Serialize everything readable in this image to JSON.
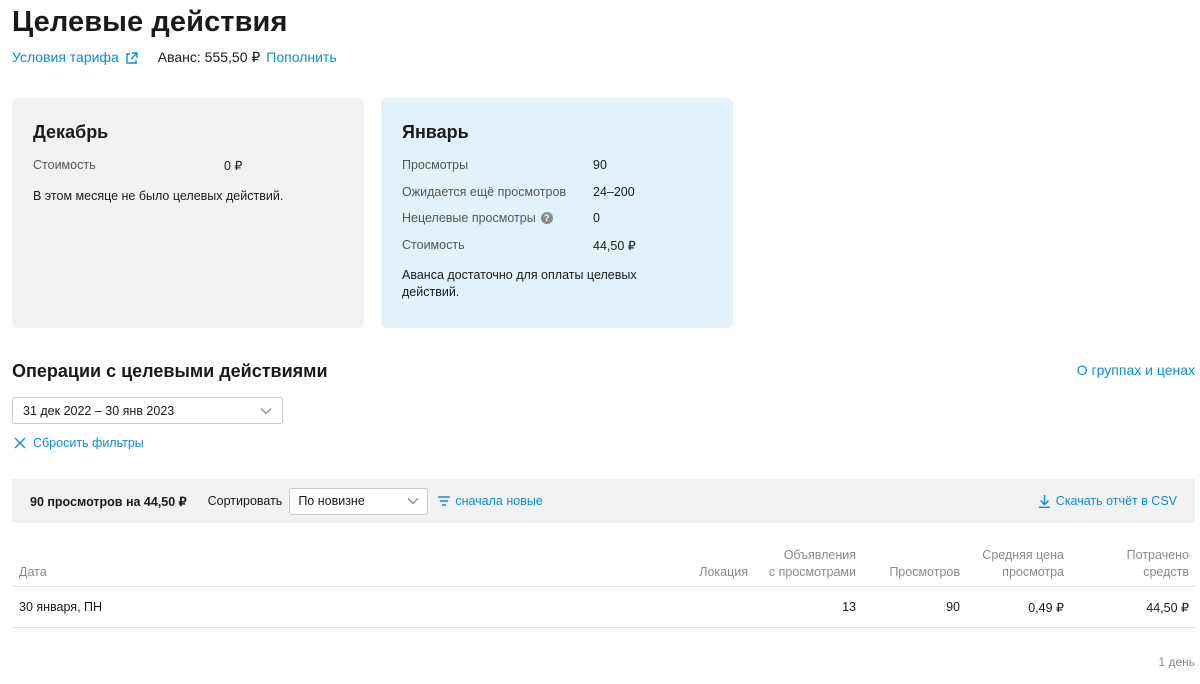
{
  "page": {
    "title": "Целевые действия",
    "tariff_link": "Условия тарифа",
    "advance": "Аванс: 555,50 ₽",
    "topup_link": "Пополнить"
  },
  "cards": {
    "december": {
      "title": "Декабрь",
      "rows": [
        {
          "label": "Стоимость",
          "value": "0 ₽"
        }
      ],
      "note": "В этом месяце не было целевых действий."
    },
    "january": {
      "title": "Январь",
      "rows": [
        {
          "label": "Просмотры",
          "value": "90"
        },
        {
          "label": "Ожидается ещё просмотров",
          "value": "24–200"
        },
        {
          "label": "Нецелевые просмотры",
          "value": "0"
        },
        {
          "label": "Стоимость",
          "value": "44,50 ₽"
        }
      ],
      "note": "Аванса достаточно для оплаты целевых действий."
    }
  },
  "operations": {
    "title": "Операции с целевыми действиями",
    "groups_link": "О группах и ценах",
    "date_range": "31 дек 2022 – 30 янв 2023",
    "reset_filters": "Сбросить фильтры",
    "summary": "90 просмотров на 44,50 ₽",
    "sort_label": "Сортировать",
    "sort_value": "По новизне",
    "order_label": "сначала новые",
    "csv_label": "Скачать отчёт в CSV"
  },
  "table": {
    "headers": {
      "date": "Дата",
      "location": "Локация",
      "ads_line1": "Объявления",
      "ads_line2": "с просмотрами",
      "views": "Просмотров",
      "avg_line1": "Средняя цена",
      "avg_line2": "просмотра",
      "spent_line1": "Потрачено",
      "spent_line2": "средств"
    },
    "rows": [
      {
        "date": "30 января, ПН",
        "location": "",
        "ads": "13",
        "views": "90",
        "avg_price": "0,49 ₽",
        "spent": "44,50 ₽"
      }
    ]
  },
  "footer": {
    "count": "1 день"
  },
  "colors": {
    "link": "#0a8dd9",
    "card_grey": "#f2f2f2",
    "card_blue": "#e1f2fc"
  }
}
